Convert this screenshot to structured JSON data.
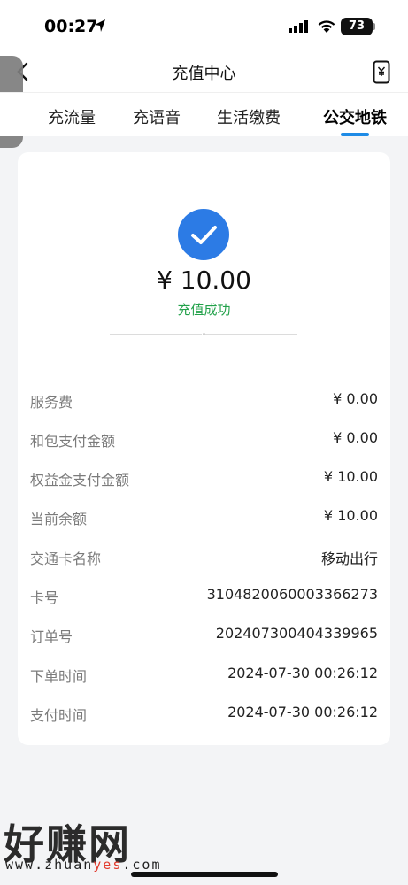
{
  "status_bar": {
    "time": "00:27",
    "battery": "73"
  },
  "nav": {
    "title": "充值中心"
  },
  "tabs": [
    {
      "label": "充流量",
      "active": false
    },
    {
      "label": "充语音",
      "active": false
    },
    {
      "label": "生活缴费",
      "active": false
    },
    {
      "label": "公交地铁",
      "active": true
    }
  ],
  "result": {
    "amount": "¥ 10.00",
    "status": "充值成功"
  },
  "details": [
    {
      "label": "服务费",
      "value": "¥ 0.00"
    },
    {
      "label": "和包支付金额",
      "value": "¥ 0.00"
    },
    {
      "label": "权益金支付金额",
      "value": "¥ 10.00"
    },
    {
      "label": "当前余额",
      "value": "¥ 10.00"
    },
    {
      "label": "交通卡名称",
      "value": "移动出行"
    },
    {
      "label": "卡号",
      "value": "3104820060003366273"
    },
    {
      "label": "订单号",
      "value": "2024073004043399​65"
    },
    {
      "label": "下单时间",
      "value": "2024-07-30 00:26:12"
    },
    {
      "label": "支付时间",
      "value": "2024-07-30 00:26:12"
    }
  ],
  "watermark": {
    "main": "好赚网",
    "url_a": "www.zhuan",
    "url_b": "yes",
    "url_c": ".com"
  },
  "colors": {
    "accent": "#1e8be6",
    "success": "#22a14a",
    "icon_circle": "#2c7be5"
  },
  "icons": [
    "location-arrow-icon",
    "signal-icon",
    "wifi-icon",
    "battery-icon",
    "back-chevron-icon",
    "receipt-yen-icon",
    "side-handle-chevron-icon",
    "checkmark-circle-icon"
  ]
}
